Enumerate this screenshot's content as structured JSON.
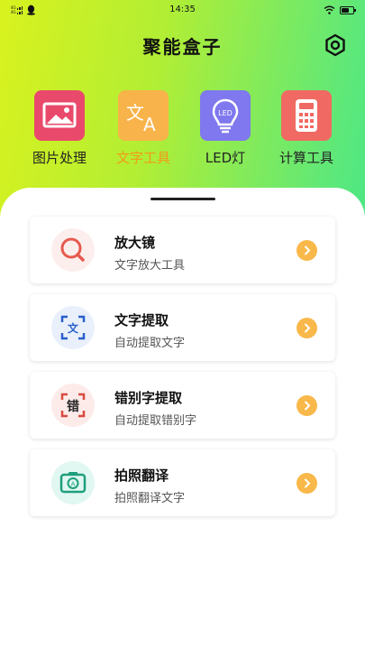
{
  "status": {
    "time": "14:35",
    "signal_text_1": "4G",
    "signal_text_2": "4G",
    "battery_level": 0.65
  },
  "header": {
    "title": "聚能盒子"
  },
  "tools": [
    {
      "label": "图片处理",
      "color": "#e9496b",
      "active": false
    },
    {
      "label": "文字工具",
      "color": "#f8b34a",
      "active": true
    },
    {
      "label": "LED灯",
      "color": "#7f78ee",
      "active": false
    },
    {
      "label": "计算工具",
      "color": "#f06a63",
      "active": false
    }
  ],
  "cards": [
    {
      "title": "放大镜",
      "subtitle": "文字放大工具",
      "icon_bg": "#fdeeee"
    },
    {
      "title": "文字提取",
      "subtitle": "自动提取文字",
      "icon_bg": "#e9f0fb"
    },
    {
      "title": "错别字提取",
      "subtitle": "自动提取错别字",
      "icon_bg": "#fdebea"
    },
    {
      "title": "拍照翻译",
      "subtitle": "拍照翻译文字",
      "icon_bg": "#e1f7f1"
    }
  ],
  "colors": {
    "accent": "#f39a18",
    "arrow": "#f9b84a"
  }
}
